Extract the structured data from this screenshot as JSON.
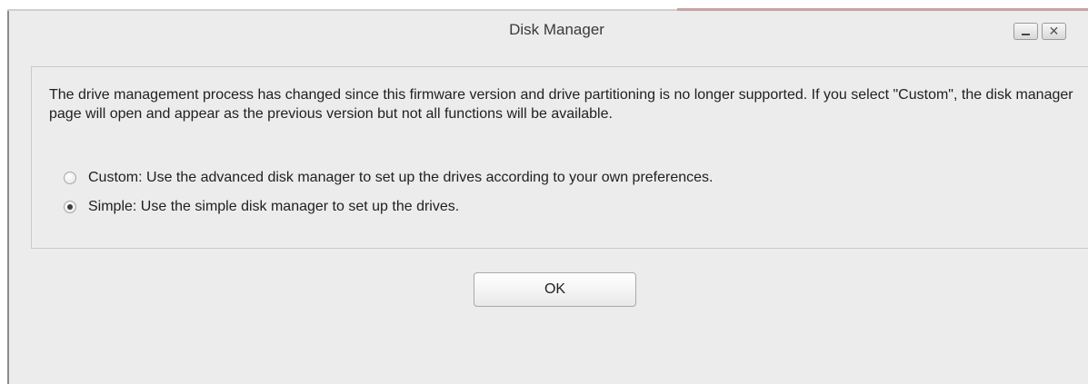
{
  "dialog": {
    "title": "Disk Manager",
    "minimize_glyph": "minimize-icon",
    "close_glyph": "✕"
  },
  "panel": {
    "message": "The drive management process has changed since this firmware version and drive partitioning is no longer supported. If you select \"Custom\", the disk manager page will open and appear as the previous version but not all functions will be available.",
    "options": [
      {
        "label": "Custom: Use the advanced disk manager to set up the drives according to your own preferences.",
        "selected": false
      },
      {
        "label": "Simple: Use the simple disk manager to set up the drives.",
        "selected": true
      }
    ]
  },
  "actions": {
    "ok_label": "OK"
  }
}
